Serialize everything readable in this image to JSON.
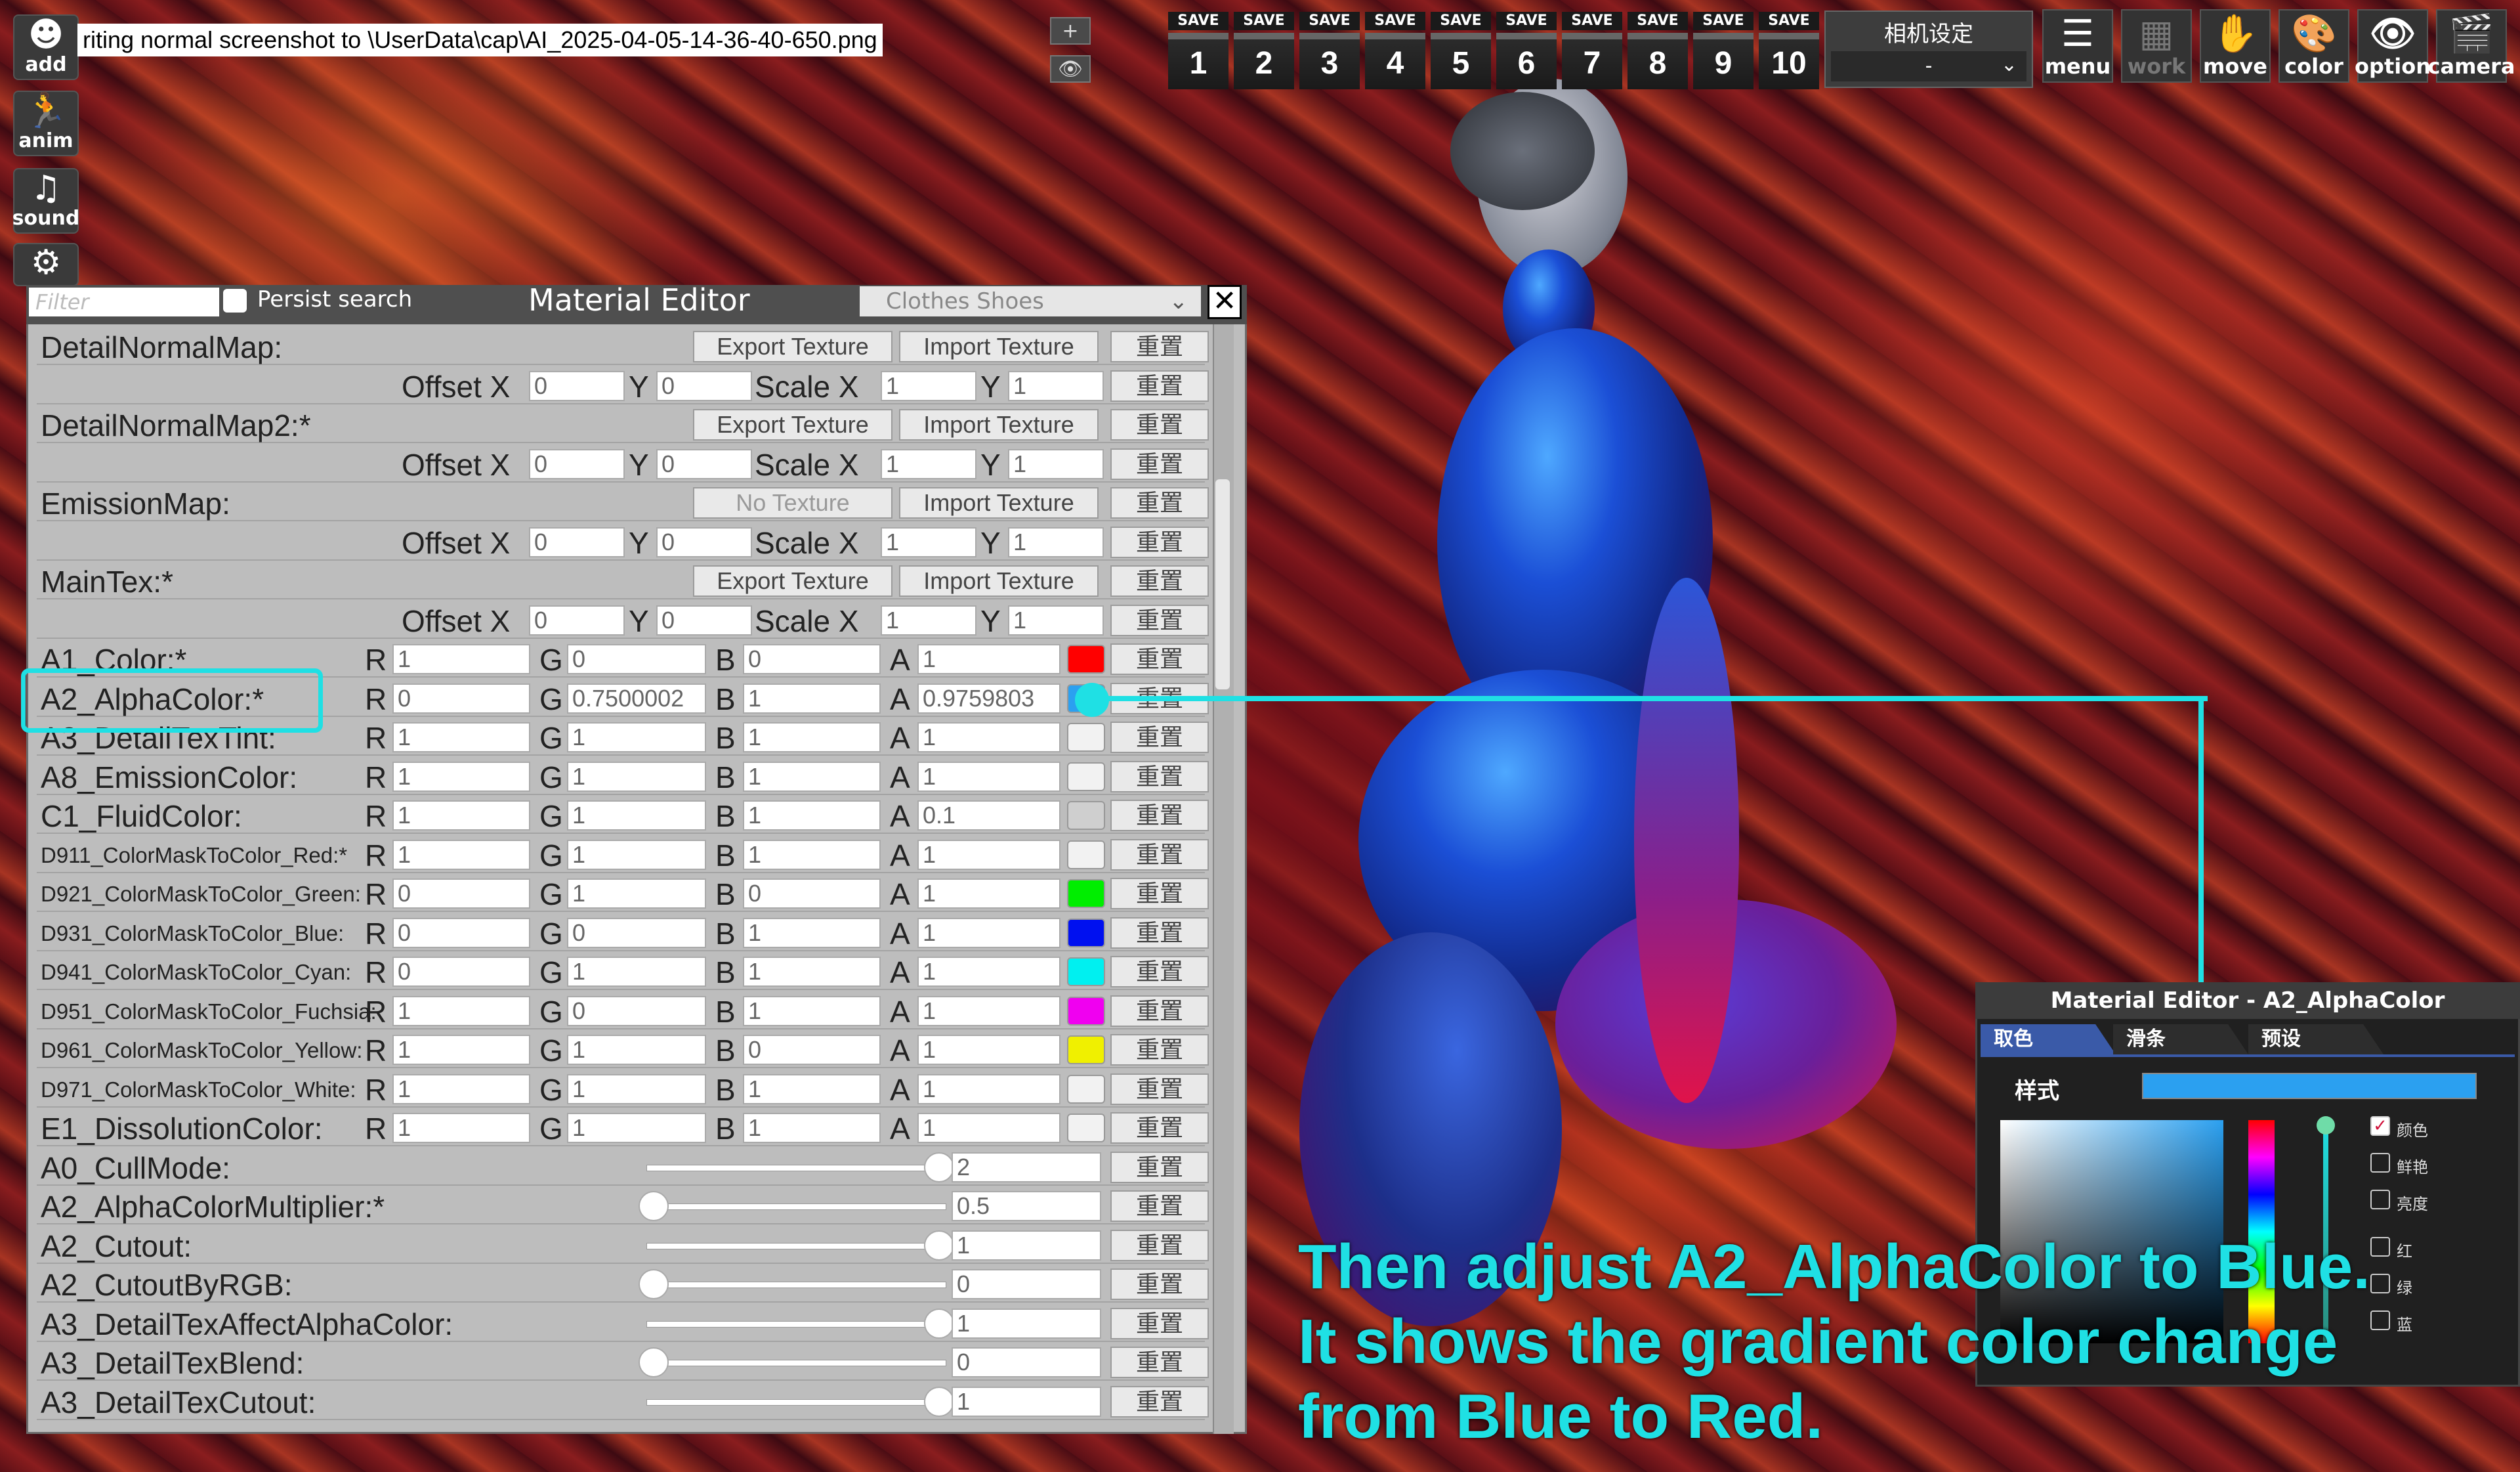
{
  "window": {
    "title": "Material Editor"
  },
  "left_toolbar": [
    {
      "name": "add",
      "label": "add",
      "glyph": "☻"
    },
    {
      "name": "anim",
      "label": "anim",
      "glyph": "🏃"
    },
    {
      "name": "sound",
      "label": "sound",
      "glyph": "♫"
    },
    {
      "name": "settings",
      "label": "s",
      "glyph": "⚙"
    }
  ],
  "status_path": "riting normal screenshot to \\UserData\\cap\\AI_2025-04-05-14-36-40-650.png",
  "small_buttons": [
    "+",
    "👁"
  ],
  "save_slots": [
    {
      "label": "SAVE",
      "num": "1"
    },
    {
      "label": "SAVE",
      "num": "2"
    },
    {
      "label": "SAVE",
      "num": "3"
    },
    {
      "label": "SAVE",
      "num": "4"
    },
    {
      "label": "SAVE",
      "num": "5"
    },
    {
      "label": "SAVE",
      "num": "6"
    },
    {
      "label": "SAVE",
      "num": "7"
    },
    {
      "label": "SAVE",
      "num": "8"
    },
    {
      "label": "SAVE",
      "num": "9"
    },
    {
      "label": "SAVE",
      "num": "10"
    }
  ],
  "camera_settings": {
    "title": "相机设定",
    "value": "-"
  },
  "top_buttons": [
    {
      "label": "menu",
      "glyph": "☰"
    },
    {
      "label": "work",
      "glyph": "▦"
    },
    {
      "label": "move",
      "glyph": "✋"
    },
    {
      "label": "color",
      "glyph": "🎨"
    },
    {
      "label": "option",
      "glyph": "👁"
    },
    {
      "label": "camera",
      "glyph": "🎬"
    }
  ],
  "editor": {
    "filter_placeholder": "Filter",
    "persist_search": "Persist search",
    "category": "Clothes Shoes",
    "close": "✕",
    "reset": "重置",
    "export": "Export Texture",
    "import": "Import Texture",
    "no_texture": "No Texture",
    "offset_x": "Offset X",
    "y": "Y",
    "scale_x": "Scale X",
    "textures": [
      {
        "label": "DetailNormalMap:",
        "has_texture": true,
        "ox": "0",
        "oy": "0",
        "sx": "1",
        "sy": "1"
      },
      {
        "label": "DetailNormalMap2:*",
        "has_texture": true,
        "ox": "0",
        "oy": "0",
        "sx": "1",
        "sy": "1"
      },
      {
        "label": "EmissionMap:",
        "has_texture": false,
        "ox": "0",
        "oy": "0",
        "sx": "1",
        "sy": "1"
      },
      {
        "label": "MainTex:*",
        "has_texture": true,
        "ox": "0",
        "oy": "0",
        "sx": "1",
        "sy": "1"
      }
    ],
    "colors": [
      {
        "label": "A1_Color:*",
        "r": "1",
        "g": "0",
        "b": "0",
        "a": "1",
        "swatch": "#ff0000",
        "small": false
      },
      {
        "label": "A2_AlphaColor:*",
        "r": "0",
        "g": "0.7500002",
        "b": "1",
        "a": "0.9759803",
        "swatch": "#2ba0f0",
        "small": false
      },
      {
        "label": "A3_DetailTexTint:",
        "r": "1",
        "g": "1",
        "b": "1",
        "a": "1",
        "swatch": "#f2f2f2",
        "small": false
      },
      {
        "label": "A8_EmissionColor:",
        "r": "1",
        "g": "1",
        "b": "1",
        "a": "1",
        "swatch": "#f2f2f2",
        "small": false
      },
      {
        "label": "C1_FluidColor:",
        "r": "1",
        "g": "1",
        "b": "1",
        "a": "0.1",
        "swatch": "#cfcfcf",
        "small": false
      },
      {
        "label": "D911_ColorMaskToColor_Red:*",
        "r": "1",
        "g": "1",
        "b": "1",
        "a": "1",
        "swatch": "#f2f2f2",
        "small": true
      },
      {
        "label": "D921_ColorMaskToColor_Green:",
        "r": "0",
        "g": "1",
        "b": "0",
        "a": "1",
        "swatch": "#00ee00",
        "small": true
      },
      {
        "label": "D931_ColorMaskToColor_Blue:",
        "r": "0",
        "g": "0",
        "b": "1",
        "a": "1",
        "swatch": "#0010f0",
        "small": true
      },
      {
        "label": "D941_ColorMaskToColor_Cyan:",
        "r": "0",
        "g": "1",
        "b": "1",
        "a": "1",
        "swatch": "#00f0f0",
        "small": true
      },
      {
        "label": "D951_ColorMaskToColor_Fuchsia:",
        "r": "1",
        "g": "0",
        "b": "1",
        "a": "1",
        "swatch": "#f000f0",
        "small": true
      },
      {
        "label": "D961_ColorMaskToColor_Yellow:",
        "r": "1",
        "g": "1",
        "b": "0",
        "a": "1",
        "swatch": "#f0f000",
        "small": true
      },
      {
        "label": "D971_ColorMaskToColor_White:",
        "r": "1",
        "g": "1",
        "b": "1",
        "a": "1",
        "swatch": "#f2f2f2",
        "small": true
      },
      {
        "label": "E1_DissolutionColor:",
        "r": "1",
        "g": "1",
        "b": "1",
        "a": "1",
        "swatch": "#f2f2f2",
        "small": false
      }
    ],
    "sliders": [
      {
        "label": "A0_CullMode:",
        "value": "2",
        "level": 1
      },
      {
        "label": "A2_AlphaColorMultiplier:*",
        "value": "0.5",
        "level": 0
      },
      {
        "label": "A2_Cutout:",
        "value": "1",
        "level": 1
      },
      {
        "label": "A2_CutoutByRGB:",
        "value": "0",
        "level": 0
      },
      {
        "label": "A3_DetailTexAffectAlphaColor:",
        "value": "1",
        "level": 1
      },
      {
        "label": "A3_DetailTexBlend:",
        "value": "0",
        "level": 0
      },
      {
        "label": "A3_DetailTexCutout:",
        "value": "1",
        "level": 1
      }
    ]
  },
  "color_picker": {
    "title": "Material Editor - A2_AlphaColor",
    "tabs": [
      "取色",
      "滑条",
      "预设"
    ],
    "style_label": "样式",
    "checks": [
      "颜色",
      "鲜艳",
      "亮度",
      "红",
      "绿",
      "蓝"
    ],
    "accent": "#1fe0e4"
  },
  "caption": [
    "Then adjust A2_AlphaColor to Blue.",
    "It shows the gradient color change",
    "from Blue to Red."
  ]
}
